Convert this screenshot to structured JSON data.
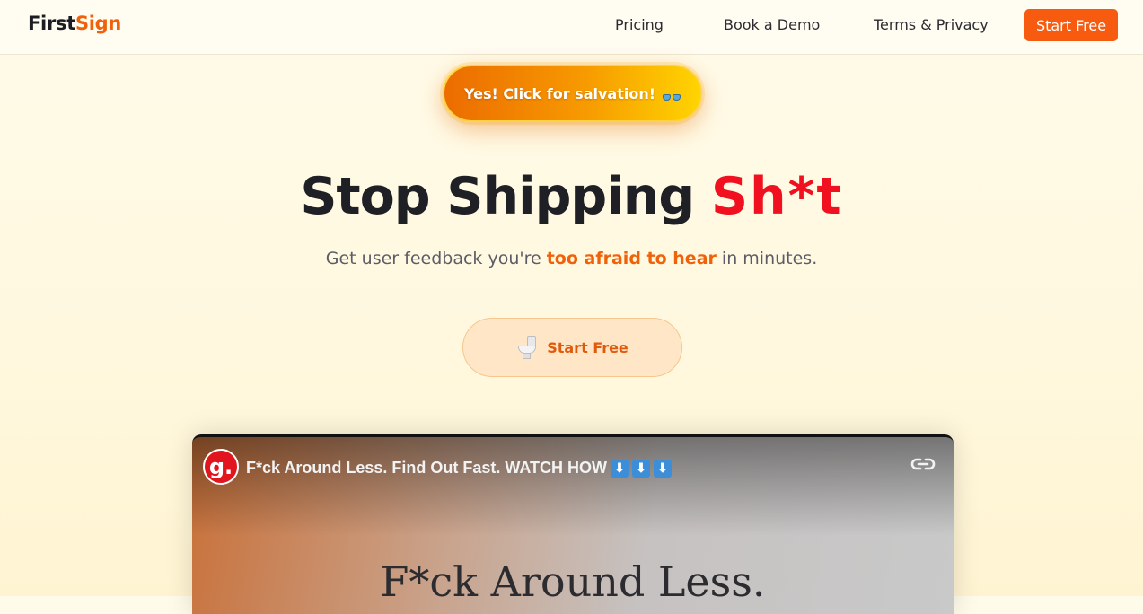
{
  "nav": {
    "logo_first": "First",
    "logo_sign": "Sign",
    "links": [
      "Pricing",
      "Book a Demo",
      "Terms & Privacy"
    ],
    "start_label": "Start Free"
  },
  "salvation_button": {
    "label": "Yes! Click for salvation!",
    "icon": "eyes-icon"
  },
  "hero": {
    "headline_main": "Stop Shipping ",
    "headline_accent": "Sh*t",
    "sub_before": "Get user feedback you're ",
    "sub_highlight": "too afraid to hear",
    "sub_after": " in minutes.",
    "cta_label": "Start Free",
    "cta_icon": "toilet-icon"
  },
  "video": {
    "channel_initial": "g.",
    "title": "F*ck Around Less. Find Out Fast. WATCH HOW",
    "title_arrows": [
      "⬇",
      "⬇",
      "⬇"
    ],
    "frame_text": "F*ck Around Less."
  },
  "colors": {
    "accent_orange": "#f65b10",
    "headline_red": "#f01020",
    "video_logo_red": "#e2151e"
  }
}
